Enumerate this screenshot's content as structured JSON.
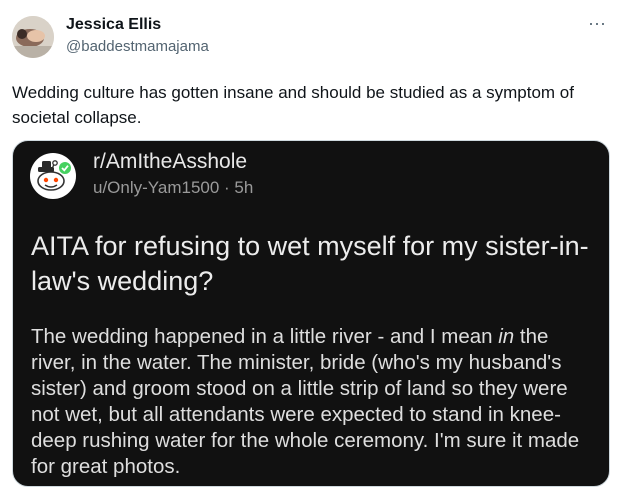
{
  "tweet": {
    "author_name": "Jessica Ellis",
    "author_handle": "@baddestmamajama",
    "more_label": "···",
    "text": "Wedding culture has gotten insane and should be studied as a symptom of societal collapse."
  },
  "reddit_post": {
    "subreddit": "r/AmItheAsshole",
    "meta": "u/Only-Yam1500 · 5h",
    "title": "AITA for refusing to wet myself for my sister-in-law's wedding?",
    "body_before_em": "The wedding happened in a little river - and I mean ",
    "body_em": "in",
    "body_after_em": " the river, in the water. The minister, bride (who's my husband's sister) and groom stood on a little strip of land so they were not wet, but all attendants were expected to stand in knee-deep rushing water for the whole ceremony. I'm sure it made for great photos."
  },
  "icons": {
    "avatar": "profile-photo",
    "subreddit_icon": "reddit-alien-icon",
    "more": "more-options-icon"
  },
  "colors": {
    "embed_background": "#111111",
    "text_primary": "#0f1419",
    "text_secondary": "#536471"
  }
}
